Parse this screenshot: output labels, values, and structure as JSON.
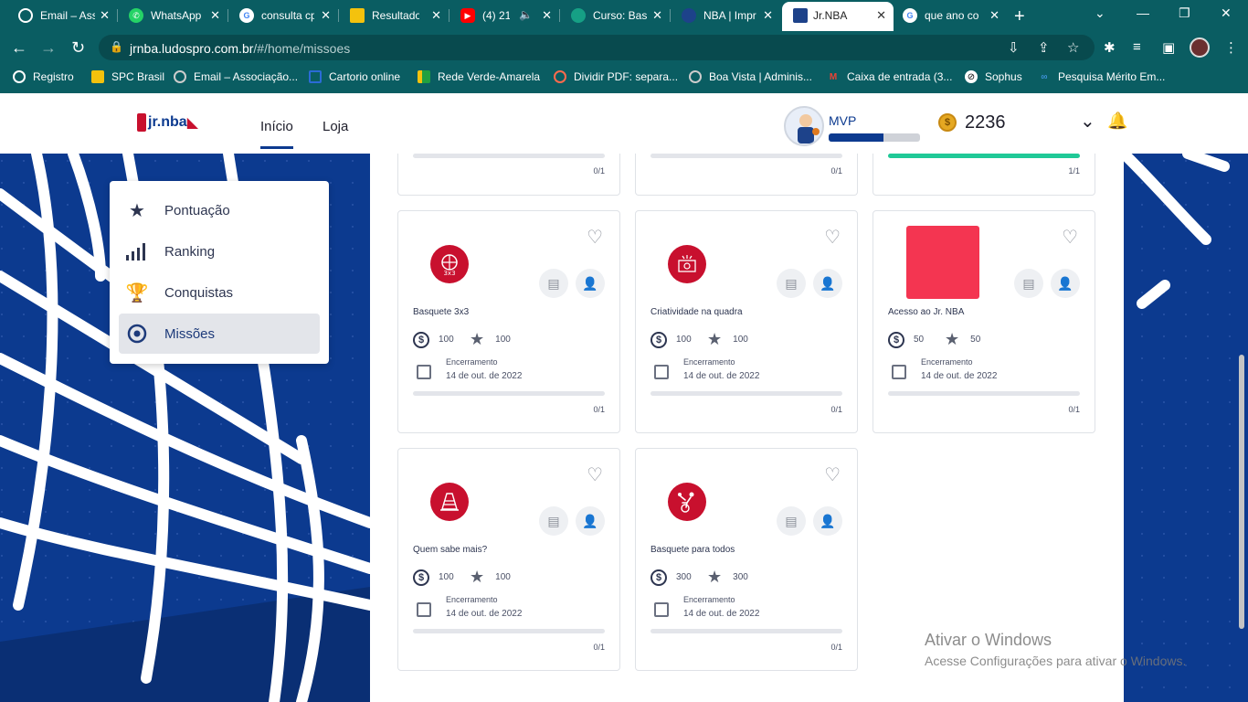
{
  "browser": {
    "tabs": [
      {
        "title": "Email – Ass",
        "icon": "globe-icon",
        "color": "#ffffff"
      },
      {
        "title": "WhatsApp",
        "icon": "whatsapp-icon",
        "color": "#25d366"
      },
      {
        "title": "consulta cp",
        "icon": "google-icon",
        "color": "#ffffff"
      },
      {
        "title": "Resultado",
        "icon": "folder-icon",
        "color": "#f4c20d"
      },
      {
        "title": "(4) 21",
        "icon": "youtube-icon",
        "color": "#ff0000"
      },
      {
        "title": "Curso: Basi",
        "icon": "course-icon",
        "color": "#16a085"
      },
      {
        "title": "NBA | Impr",
        "icon": "nba-icon",
        "color": "#1d428a"
      },
      {
        "title": "Jr.NBA",
        "icon": "jrnba-icon",
        "color": "#1d428a"
      },
      {
        "title": "que ano co",
        "icon": "google-icon",
        "color": "#ffffff"
      }
    ],
    "url_host": "jrnba.ludospro.com.br",
    "url_path": "/#/home/missoes",
    "bookmarks": [
      {
        "label": "Registro",
        "icon": "globe-icon"
      },
      {
        "label": "SPC Brasil",
        "icon": "spc-icon"
      },
      {
        "label": "Email – Associação...",
        "icon": "globe-icon"
      },
      {
        "label": "Cartorio online",
        "icon": "cartorio-icon"
      },
      {
        "label": "Rede Verde-Amarela",
        "icon": "flag-icon"
      },
      {
        "label": "Dividir PDF: separa...",
        "icon": "pdf-icon"
      },
      {
        "label": "Boa Vista | Adminis...",
        "icon": "globe-icon"
      },
      {
        "label": "Caixa de entrada (3...",
        "icon": "gmail-icon"
      },
      {
        "label": "Sophus",
        "icon": "sophus-icon"
      },
      {
        "label": "Pesquisa Mérito Em...",
        "icon": "link-icon"
      }
    ]
  },
  "header": {
    "logo_text": "jr.nba",
    "nav": [
      "Início",
      "Loja"
    ],
    "level": "MVP",
    "level_progress": 0.6,
    "coins": "2236"
  },
  "side_menu": [
    {
      "label": "Pontuação",
      "icon": "star-icon"
    },
    {
      "label": "Ranking",
      "icon": "ranking-icon"
    },
    {
      "label": "Conquistas",
      "icon": "trophy-icon"
    },
    {
      "label": "Missões",
      "icon": "target-icon"
    }
  ],
  "top_partial": [
    {
      "count": "0/1",
      "progress": 0
    },
    {
      "count": "0/1",
      "progress": 0
    },
    {
      "count": "1/1",
      "progress": 1
    }
  ],
  "missions": [
    {
      "name": "Basquete 3x3",
      "coins": "100",
      "points": "100",
      "end_label": "Encerramento",
      "end_date": "14 de out. de 2022",
      "count": "0/1",
      "progress": 0,
      "badge": "3x3"
    },
    {
      "name": "Criatividade na quadra",
      "coins": "100",
      "points": "100",
      "end_label": "Encerramento",
      "end_date": "14 de out. de 2022",
      "count": "0/1",
      "progress": 0,
      "badge": "court"
    },
    {
      "name": "Acesso ao Jr. NBA",
      "coins": "50",
      "points": "50",
      "end_label": "Encerramento",
      "end_date": "14 de out. de 2022",
      "count": "0/1",
      "progress": 0,
      "badge": "square"
    },
    {
      "name": "Quem sabe mais?",
      "coins": "100",
      "points": "100",
      "end_label": "Encerramento",
      "end_date": "14 de out. de 2022",
      "count": "0/1",
      "progress": 0,
      "badge": "cone"
    },
    {
      "name": "Basquete para todos",
      "coins": "300",
      "points": "300",
      "end_label": "Encerramento",
      "end_date": "14 de out. de 2022",
      "count": "0/1",
      "progress": 0,
      "badge": "player"
    }
  ],
  "watermark": {
    "line1": "Ativar o Windows",
    "line2": "Acesse Configurações para ativar o Windows."
  }
}
